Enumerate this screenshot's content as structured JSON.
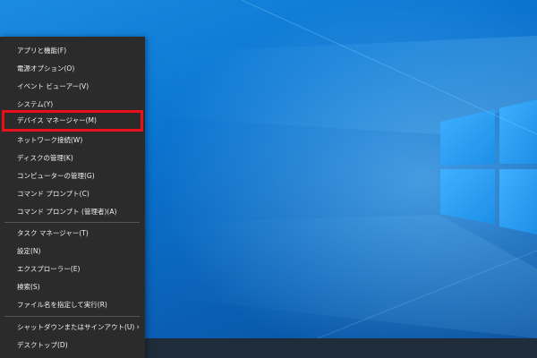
{
  "colors": {
    "menu_bg": "#2b2b2b",
    "menu_text": "#f2f2f2",
    "highlight_border": "#e8101a",
    "desktop_blue": "#0a74d0",
    "taskbar": "#1f2d3a"
  },
  "menu": {
    "groups": [
      {
        "items": [
          {
            "label": "アプリと機能(F)"
          },
          {
            "label": "電源オプション(O)"
          },
          {
            "label": "イベント ビューアー(V)"
          },
          {
            "label": "システム(Y)"
          },
          {
            "label": "デバイス マネージャー(M)",
            "highlighted": true
          },
          {
            "label": "ネットワーク接続(W)"
          },
          {
            "label": "ディスクの管理(K)"
          },
          {
            "label": "コンピューターの管理(G)"
          },
          {
            "label": "コマンド プロンプト(C)"
          },
          {
            "label": "コマンド プロンプト (管理者)(A)"
          }
        ]
      },
      {
        "items": [
          {
            "label": "タスク マネージャー(T)"
          },
          {
            "label": "設定(N)"
          },
          {
            "label": "エクスプローラー(E)"
          },
          {
            "label": "検索(S)"
          },
          {
            "label": "ファイル名を指定して実行(R)"
          }
        ]
      },
      {
        "items": [
          {
            "label": "シャットダウンまたはサインアウト(U)",
            "submenu_icon": "chevron-right-icon"
          },
          {
            "label": "デスクトップ(D)"
          }
        ]
      }
    ]
  }
}
